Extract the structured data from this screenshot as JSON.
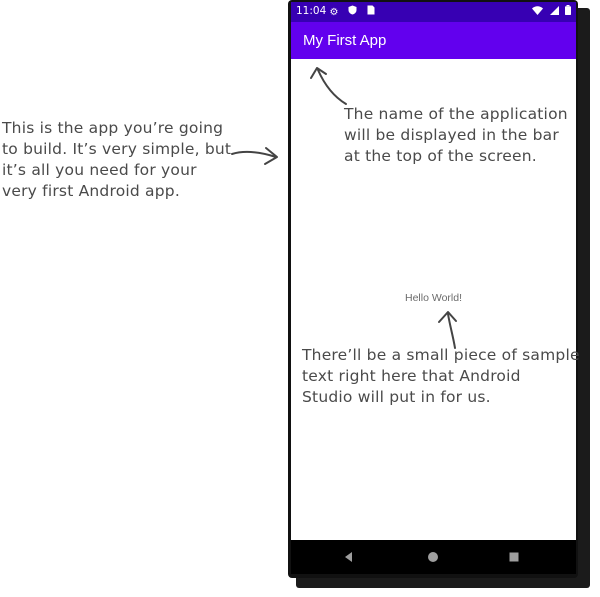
{
  "annotations": {
    "left": [
      "This is the app you’re going",
      "to build. It’s very simple, but",
      "it’s all you need for your",
      "very first Android app."
    ],
    "top_right": [
      "The name of the application",
      "will be displayed in the bar",
      "at the top of the screen."
    ],
    "bottom": [
      "There’ll be a small piece of sample",
      "text right here that Android",
      "Studio will put in for us."
    ]
  },
  "phone": {
    "status_bar": {
      "time": "11:04",
      "left_icons": [
        "gear-icon",
        "shield-icon",
        "sim-icon"
      ],
      "right_icons": [
        "wifi-icon",
        "signal-icon",
        "battery-icon"
      ]
    },
    "app_bar": {
      "title": "My First App"
    },
    "content": {
      "sample_text": "Hello World!"
    },
    "nav_bar": {
      "buttons": [
        "back-icon",
        "home-icon",
        "recents-icon"
      ]
    }
  },
  "colors": {
    "status_bar": "#3700b3",
    "app_bar": "#6200ee",
    "annotation_text": "#4a4a4a",
    "sample_text": "#6b6b6b"
  }
}
